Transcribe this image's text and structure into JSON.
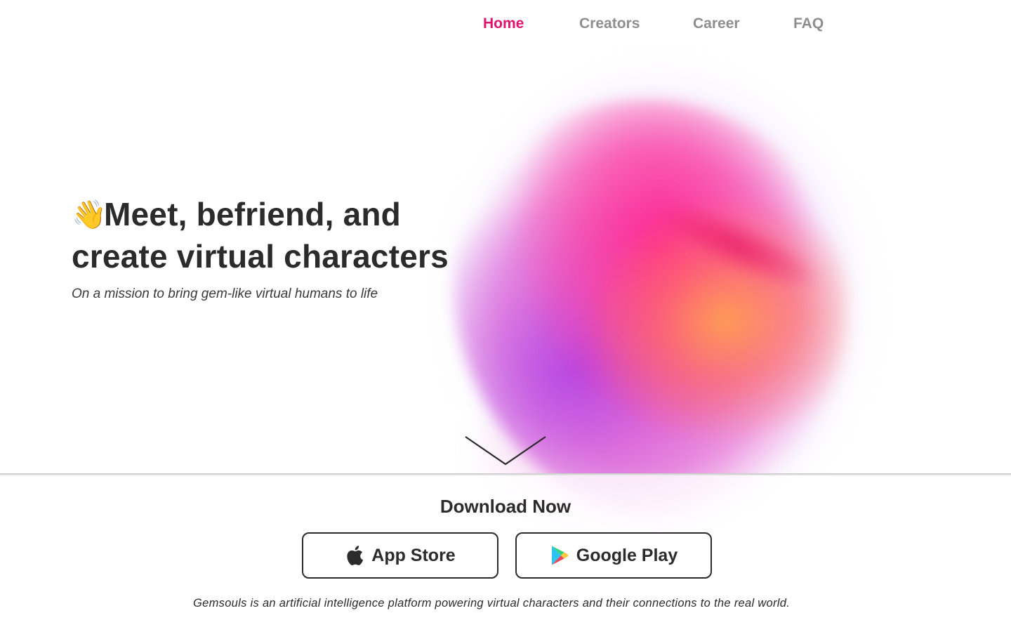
{
  "nav": {
    "items": [
      {
        "label": "Home",
        "active": true
      },
      {
        "label": "Creators",
        "active": false
      },
      {
        "label": "Career",
        "active": false
      },
      {
        "label": "FAQ",
        "active": false
      }
    ],
    "active_color": "#e2136e",
    "inactive_color": "#8e8e8e"
  },
  "hero": {
    "wave_emoji": "👋",
    "title_line1": "Meet, befriend, and",
    "title_line2": "create virtual characters",
    "subtitle": "On a mission to bring gem-like virtual humans to life"
  },
  "download": {
    "title": "Download Now",
    "app_store_label": "App Store",
    "app_store_icon": "apple-icon",
    "google_play_label": "Google Play",
    "google_play_icon": "google-play-icon"
  },
  "footer": {
    "description": "Gemsouls is an artificial intelligence platform powering virtual characters and their connections to the real world."
  },
  "colors": {
    "text": "#2b2b2b",
    "accent": "#e2136e",
    "background": "#ffffff"
  }
}
